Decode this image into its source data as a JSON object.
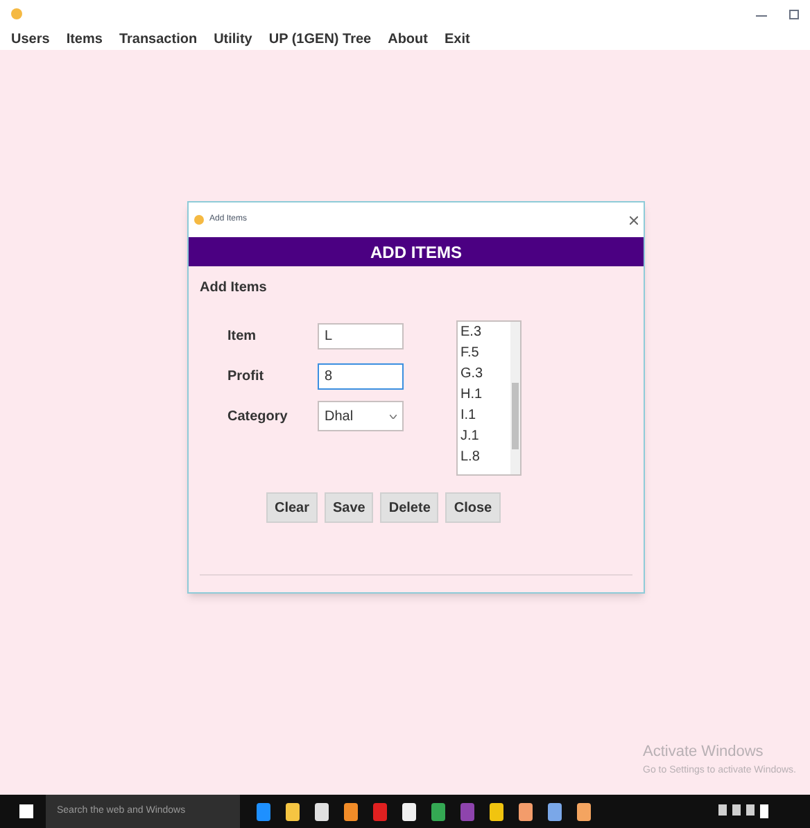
{
  "menu": [
    {
      "label": "Users"
    },
    {
      "label": "Items"
    },
    {
      "label": "Transaction"
    },
    {
      "label": "Utility"
    },
    {
      "label": "UP (1GEN) Tree"
    },
    {
      "label": "About"
    },
    {
      "label": "Exit"
    }
  ],
  "dialog": {
    "title": "Add Items",
    "header": "ADD ITEMS",
    "group": "Add Items",
    "fields": [
      {
        "kind": "text",
        "label": "Item",
        "value": "L",
        "focused": false
      },
      {
        "kind": "text",
        "label": "Profit",
        "value": "8",
        "focused": true
      },
      {
        "kind": "select",
        "label": "Category",
        "value": "Dhal",
        "focused": false
      }
    ],
    "list": [
      "E.3",
      "F.5",
      "G.3",
      "H.1",
      "I.1",
      "J.1",
      "L.8"
    ],
    "buttons": [
      "Clear",
      "Save",
      "Delete",
      "Close"
    ]
  },
  "activation": {
    "title": "Activate Windows",
    "subtitle": "Go to Settings to activate Windows."
  },
  "taskbar": {
    "search": {
      "placeholder": "Search the web and Windows"
    }
  }
}
